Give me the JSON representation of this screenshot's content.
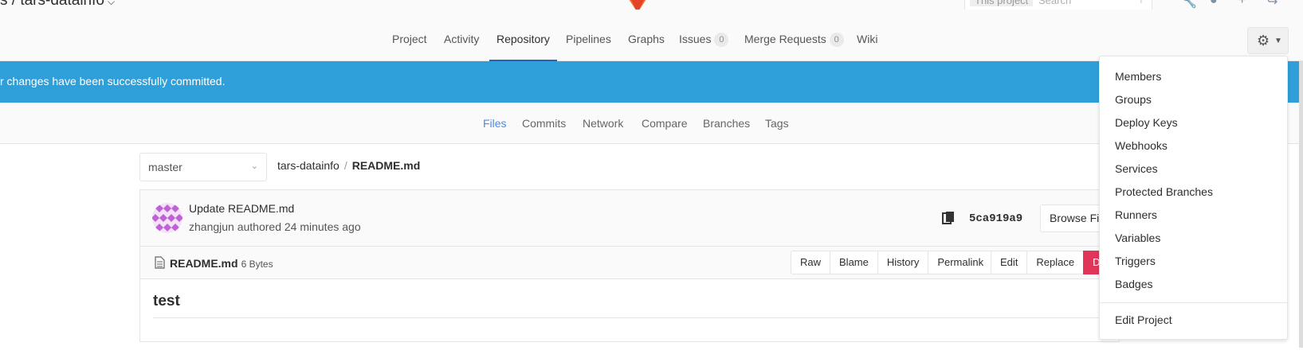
{
  "header": {
    "project_path": "s / tars-datainfo",
    "search_scope": "This project",
    "search_placeholder": "Search"
  },
  "project_nav": {
    "tabs": [
      {
        "label": "Project"
      },
      {
        "label": "Activity"
      },
      {
        "label": "Repository",
        "active": true
      },
      {
        "label": "Pipelines"
      },
      {
        "label": "Graphs"
      },
      {
        "label": "Issues",
        "count": "0"
      },
      {
        "label": "Merge Requests",
        "count": "0"
      },
      {
        "label": "Wiki"
      }
    ]
  },
  "flash": {
    "message": "r changes have been successfully committed.",
    "color": "#2f9fd9"
  },
  "sub_nav": {
    "tabs": [
      {
        "label": "Files",
        "active": true
      },
      {
        "label": "Commits"
      },
      {
        "label": "Network"
      },
      {
        "label": "Compare"
      },
      {
        "label": "Branches"
      },
      {
        "label": "Tags"
      }
    ]
  },
  "file_path": {
    "branch": "master",
    "repo": "tars-datainfo",
    "separator": "/",
    "file": "README.md"
  },
  "commit": {
    "title": "Update README.md",
    "author_line": "zhangjun authored 24 minutes ago",
    "sha": "5ca919a9",
    "browse_label": "Browse Files"
  },
  "file_header": {
    "name": "README.md",
    "size": "6 Bytes",
    "actions": [
      "Raw",
      "Blame",
      "History",
      "Permalink"
    ],
    "edit_actions": [
      "Edit",
      "Replace",
      "Delete"
    ],
    "danger_color": "#e2355a"
  },
  "file_content": {
    "heading": "test"
  },
  "settings_menu": {
    "items": [
      "Members",
      "Groups",
      "Deploy Keys",
      "Webhooks",
      "Services",
      "Protected Branches",
      "Runners",
      "Variables",
      "Triggers",
      "Badges"
    ],
    "footer_item": "Edit Project"
  }
}
